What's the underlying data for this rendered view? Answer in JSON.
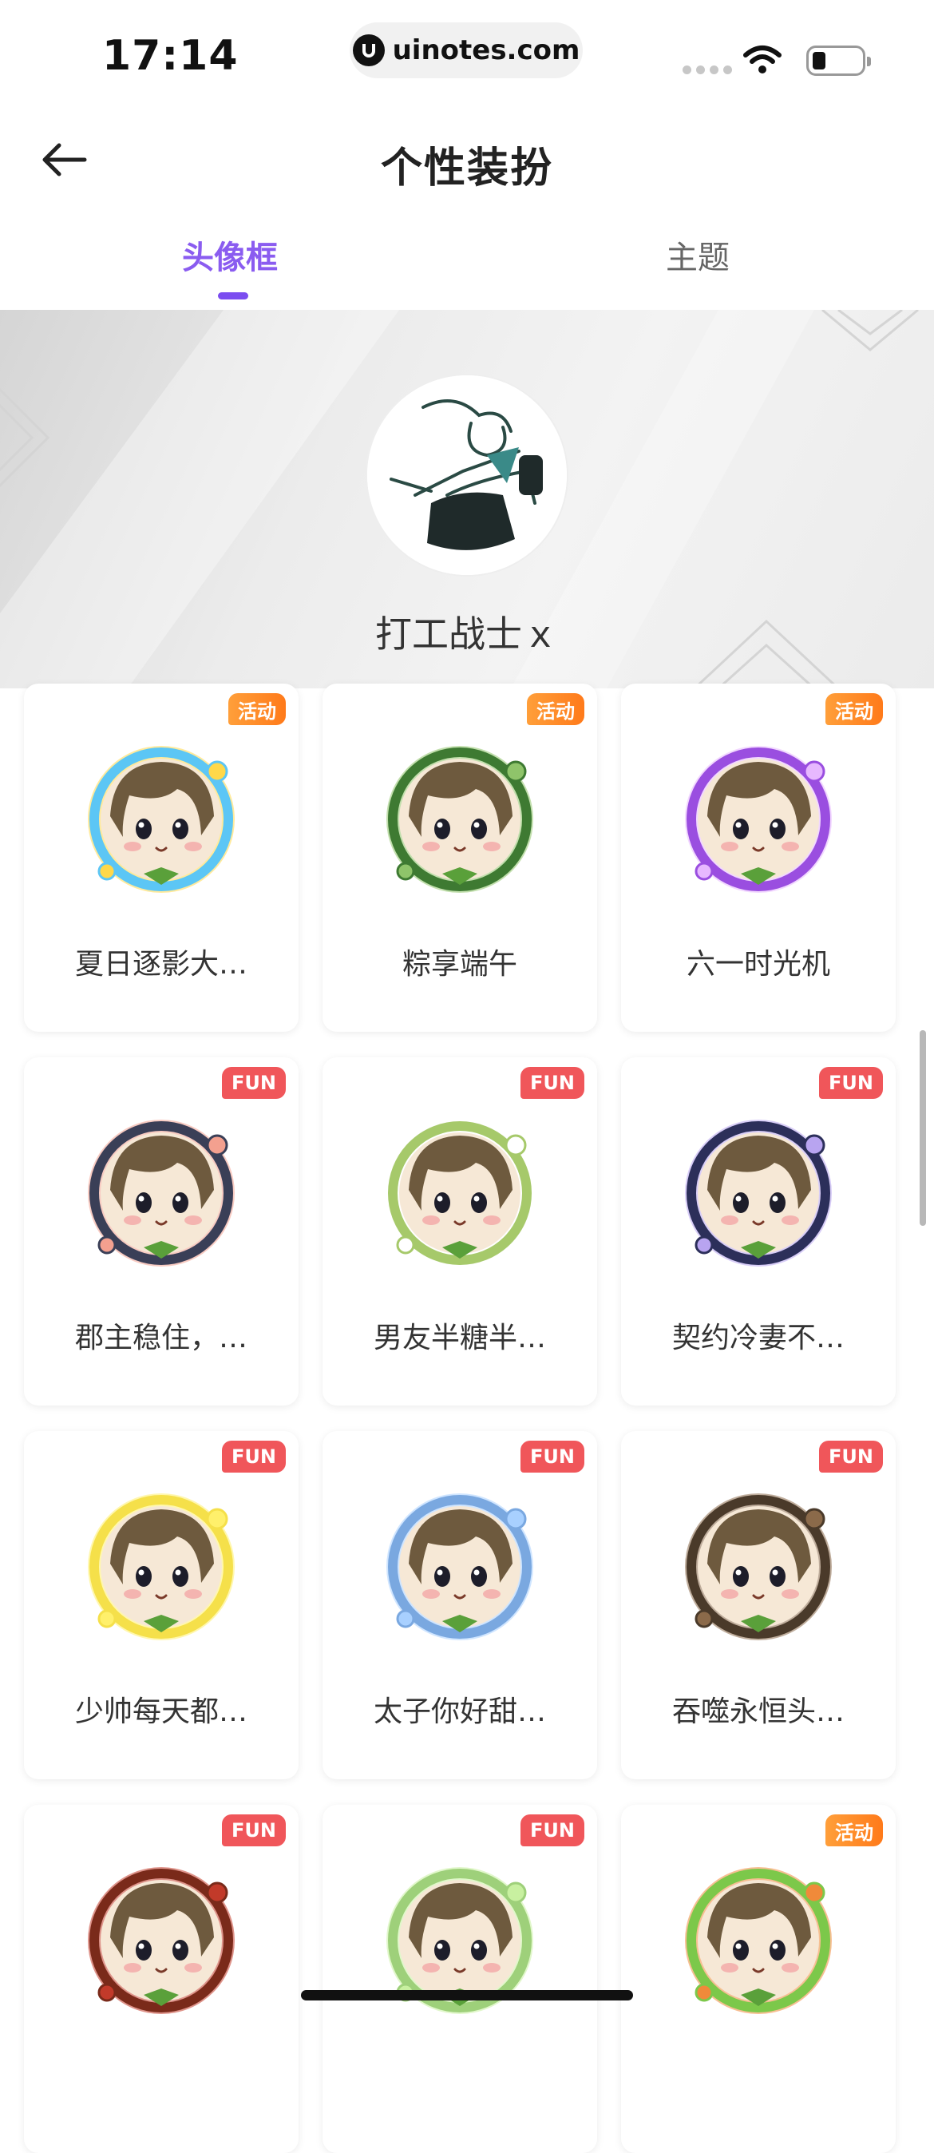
{
  "status_bar": {
    "time": "17:14",
    "url": "uinotes.com",
    "logo_icon": "uinotes-logo-icon",
    "wifi_icon": "wifi-icon",
    "battery_icon": "battery-icon"
  },
  "header": {
    "title": "个性装扮",
    "back_icon": "arrow-left-icon"
  },
  "tabs": [
    {
      "label": "头像框",
      "active": true
    },
    {
      "label": "主题",
      "active": false
    }
  ],
  "profile": {
    "username": "打工战士ｘ"
  },
  "colors": {
    "accent": "#8a5cf0",
    "activity_badge": "#ff8a25",
    "fun_badge": "#f0565a"
  },
  "frames": [
    {
      "name": "夏日逐影大…",
      "badge": "活动",
      "badge_type": "activity",
      "ring": "#5cc6f5",
      "deco": "#ffd84a"
    },
    {
      "name": "粽享端午",
      "badge": "活动",
      "badge_type": "activity",
      "ring": "#3e7a32",
      "deco": "#8fc46a"
    },
    {
      "name": "六一时光机",
      "badge": "活动",
      "badge_type": "activity",
      "ring": "#9a4ee0",
      "deco": "#e7b8ff"
    },
    {
      "name": "郡主稳住，…",
      "badge": "FUN",
      "badge_type": "fun",
      "ring": "#3a3f57",
      "deco": "#f3a08f"
    },
    {
      "name": "男友半糖半…",
      "badge": "FUN",
      "badge_type": "fun",
      "ring": "#a6c96a",
      "deco": "#ffffff"
    },
    {
      "name": "契约冷妻不…",
      "badge": "FUN",
      "badge_type": "fun",
      "ring": "#2c2f5a",
      "deco": "#b8a4f0"
    },
    {
      "name": "少帅每天都…",
      "badge": "FUN",
      "badge_type": "fun",
      "ring": "#f5e04a",
      "deco": "#fff06b"
    },
    {
      "name": "太子你好甜…",
      "badge": "FUN",
      "badge_type": "fun",
      "ring": "#7aa8e0",
      "deco": "#a8d0ff"
    },
    {
      "name": "吞噬永恒头…",
      "badge": "FUN",
      "badge_type": "fun",
      "ring": "#4a3a2a",
      "deco": "#8b6a4a"
    },
    {
      "name": "",
      "badge": "FUN",
      "badge_type": "fun",
      "ring": "#7a2a1a",
      "deco": "#c23a2a"
    },
    {
      "name": "",
      "badge": "FUN",
      "badge_type": "fun",
      "ring": "#9ed07a",
      "deco": "#c8f0a0"
    },
    {
      "name": "",
      "badge": "活动",
      "badge_type": "activity",
      "ring": "#7cc84a",
      "deco": "#f08a3a"
    }
  ]
}
